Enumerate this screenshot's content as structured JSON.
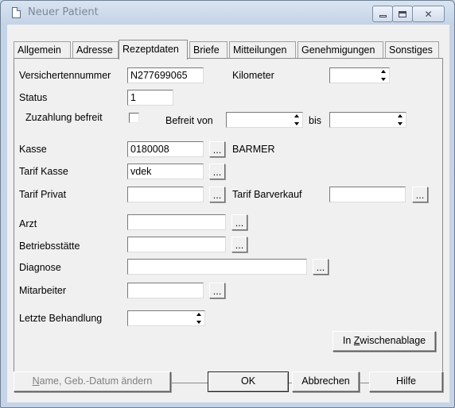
{
  "window": {
    "title": "Neuer Patient"
  },
  "tabs": [
    {
      "label": "Allgemein",
      "active": false
    },
    {
      "label": "Adresse",
      "active": false
    },
    {
      "label": "Rezeptdaten",
      "active": true
    },
    {
      "label": "Briefe",
      "active": false
    },
    {
      "label": "Mitteilungen",
      "active": false
    },
    {
      "label": "Genehmigungen",
      "active": false
    },
    {
      "label": "Sonstiges",
      "active": false
    }
  ],
  "form": {
    "versichertennummer": {
      "label": "Versichertennummer",
      "value": "N277699065"
    },
    "kilometer": {
      "label": "Kilometer",
      "value": ""
    },
    "status": {
      "label": "Status",
      "value": "1"
    },
    "zuzahlung_befreit": {
      "label": "Zuzahlung befreit",
      "checked": false
    },
    "befreit_von": {
      "label": "Befreit von",
      "value": ""
    },
    "bis": {
      "label": "bis",
      "value": ""
    },
    "kasse": {
      "label": "Kasse",
      "value": "0180008",
      "name": "BARMER",
      "button": "..."
    },
    "tarif_kasse": {
      "label": "Tarif Kasse",
      "value": "vdek",
      "button": "..."
    },
    "tarif_privat": {
      "label": "Tarif Privat",
      "value": "",
      "button": "..."
    },
    "tarif_barverkauf": {
      "label": "Tarif Barverkauf",
      "value": "",
      "button": "..."
    },
    "arzt": {
      "label": "Arzt",
      "value": "",
      "button": "..."
    },
    "betriebsstaette": {
      "label": "Betriebsstätte",
      "value": "",
      "button": "..."
    },
    "diagnose": {
      "label": "Diagnose",
      "value": "",
      "button": "..."
    },
    "mitarbeiter": {
      "label": "Mitarbeiter",
      "value": "",
      "button": "..."
    },
    "letzte_behandlung": {
      "label": "Letzte Behandlung",
      "value": ""
    },
    "zwischenablage_prefix": "In ",
    "zwischenablage_hotkey": "Z",
    "zwischenablage_rest": "wischenablage"
  },
  "buttons": {
    "rename_hotkey": "N",
    "rename_rest": "ame, Geb.-Datum ändern",
    "ok": "OK",
    "cancel": "Abbrechen",
    "help": "Hilfe"
  }
}
